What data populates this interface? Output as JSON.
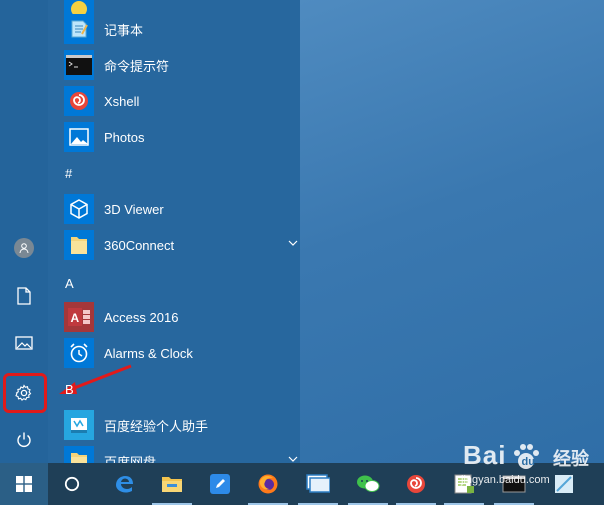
{
  "start_menu": {
    "apps": [
      {
        "label": "",
        "icon": "app-icon-partial"
      },
      {
        "label": "记事本",
        "icon": "notepad-icon"
      },
      {
        "label": "命令提示符",
        "icon": "command-prompt-icon"
      },
      {
        "label": "Xshell",
        "icon": "xshell-icon"
      },
      {
        "label": "Photos",
        "icon": "photos-icon"
      },
      {
        "section": "#"
      },
      {
        "label": "3D Viewer",
        "icon": "3d-viewer-icon"
      },
      {
        "label": "360Connect",
        "icon": "folder-icon",
        "expandable": true
      },
      {
        "section": "A"
      },
      {
        "label": "Access 2016",
        "icon": "access-icon"
      },
      {
        "label": "Alarms & Clock",
        "icon": "alarm-clock-icon"
      },
      {
        "label": "百度经验个人助手",
        "icon": "baidu-assistant-icon"
      },
      {
        "label": "百度网盘",
        "icon": "folder-icon",
        "expandable": true
      }
    ],
    "section_hash": "#",
    "section_a": "A",
    "section_b": "B"
  },
  "rail": {
    "items": [
      "user-icon",
      "documents-icon",
      "pictures-icon",
      "settings-icon",
      "power-icon"
    ]
  },
  "taskbar": {
    "items": [
      "start-icon",
      "cortana-icon",
      "edge-icon",
      "file-explorer-icon",
      "whiteboard-icon",
      "firefox-icon",
      "remote-desktop-icon",
      "wechat-icon",
      "xshell-icon",
      "notepad-plus-icon",
      "terminal-icon",
      "app-icon"
    ]
  },
  "watermark": {
    "brand": "Bai",
    "brand_suffix": "经验",
    "url": "jingyan.baidu.com"
  },
  "colors": {
    "start_menu_bg": "#27679e",
    "tile_blue": "#0078d7",
    "highlight": "#e11a1a"
  }
}
